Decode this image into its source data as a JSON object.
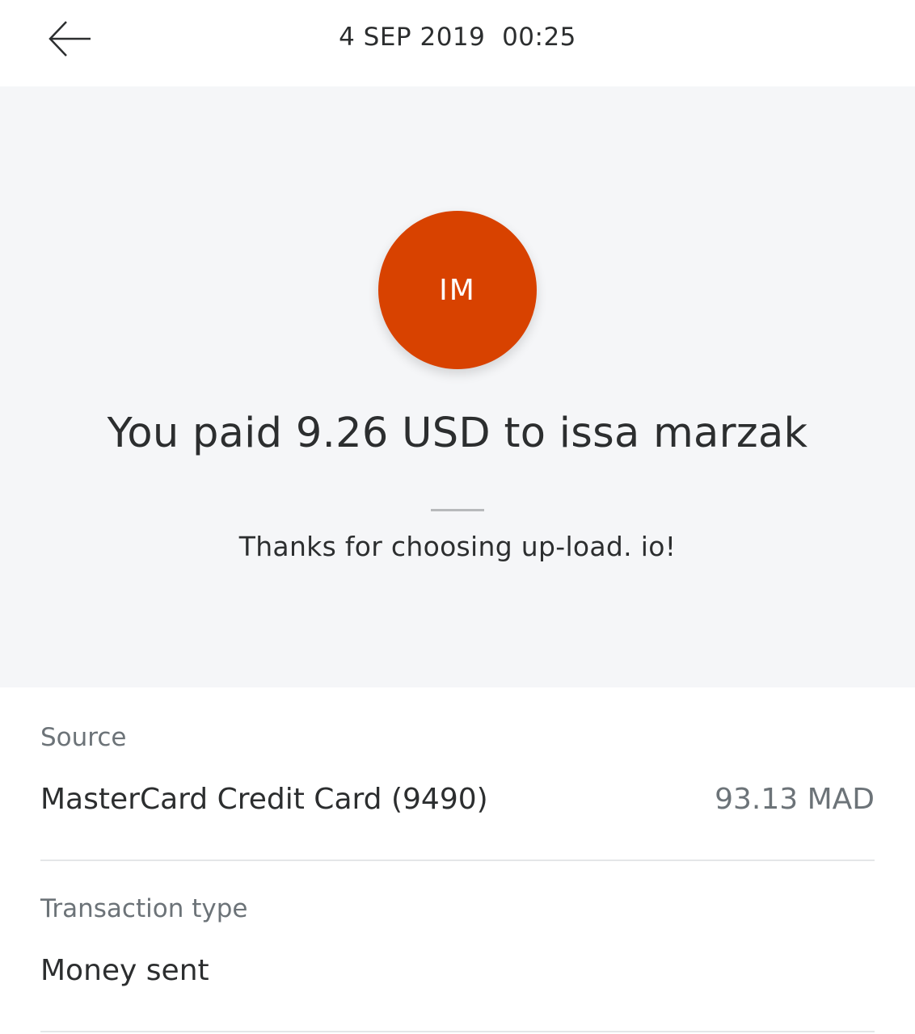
{
  "header": {
    "back_icon": "arrow-left-icon",
    "datetime": "4 SEP 2019  00:25"
  },
  "summary": {
    "avatar_initials": "IM",
    "avatar_color": "#d84200",
    "headline": "You paid 9.26 USD to issa marzak",
    "thanks_note": "Thanks for choosing up-load. io!"
  },
  "details": [
    {
      "label": "Source",
      "value": "MasterCard Credit Card (9490)",
      "amount": "93.13 MAD"
    },
    {
      "label": "Transaction type",
      "value": "Money sent"
    }
  ]
}
